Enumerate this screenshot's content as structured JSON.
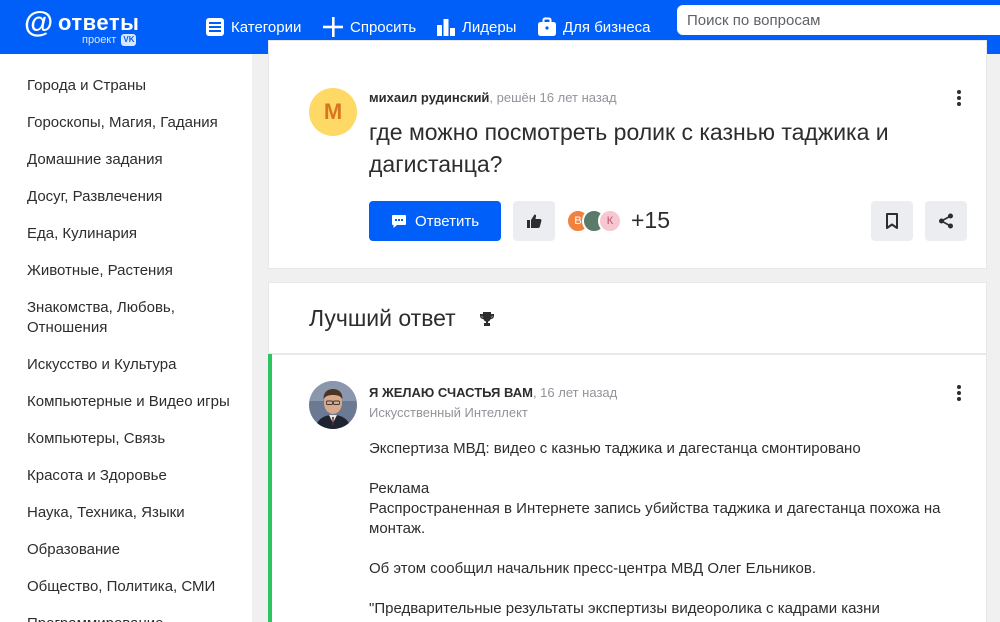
{
  "header": {
    "logo_text": "ответы",
    "logo_sub": "проект",
    "logo_badge": "VK",
    "nav": [
      {
        "label": "Категории",
        "icon": "menu-list-icon"
      },
      {
        "label": "Спросить",
        "icon": "plus-icon"
      },
      {
        "label": "Лидеры",
        "icon": "bar-chart-icon"
      },
      {
        "label": "Для бизнеса",
        "icon": "briefcase-icon"
      }
    ],
    "search_placeholder": "Поиск по вопросам"
  },
  "sidebar": {
    "items": [
      "Города и Страны",
      "Гороскопы, Магия, Гадания",
      "Домашние задания",
      "Досуг, Развлечения",
      "Еда, Кулинария",
      "Животные, Растения",
      "Знакомства, Любовь, Отношения",
      "Искусство и Культура",
      "Компьютерные и Видео игры",
      "Компьютеры, Связь",
      "Красота и Здоровье",
      "Наука, Техника, Языки",
      "Образование",
      "Общество, Политика, СМИ",
      "Программирование"
    ]
  },
  "question": {
    "avatar_letter": "М",
    "author": "михаил рудинский",
    "time": ", решён 16 лет назад",
    "title": "где можно посмотреть ролик с казнью таджика и дагистанца?",
    "answer_button": "Ответить",
    "participants": [
      {
        "letter": "В",
        "color": "#f0813f"
      },
      {
        "letter": "",
        "color": "#5a7a6a"
      },
      {
        "letter": "К",
        "color": "#f7c7d0"
      }
    ],
    "participants_more": "+15"
  },
  "best_answer": {
    "heading": "Лучший ответ",
    "author": "Я ЖЕЛАЮ СЧАСТЬЯ ВАМ",
    "time": ", 16 лет назад",
    "rank": "Искусственный Интеллект",
    "paragraphs": [
      "Экспертиза МВД: видео с казнью таджика и дагестанца смонтировано",
      "Реклама",
      "Распространенная в Интернете запись убийства таджика и дагестанца похожа на монтаж.",
      "Об этом сообщил начальник пресс-центра МВД Олег Ельников.",
      "\"Предварительные результаты экспертизы видеоролика с кадрами казни"
    ]
  },
  "colors": {
    "brand": "#005ff9",
    "best_answer_accent": "#2dc562"
  }
}
